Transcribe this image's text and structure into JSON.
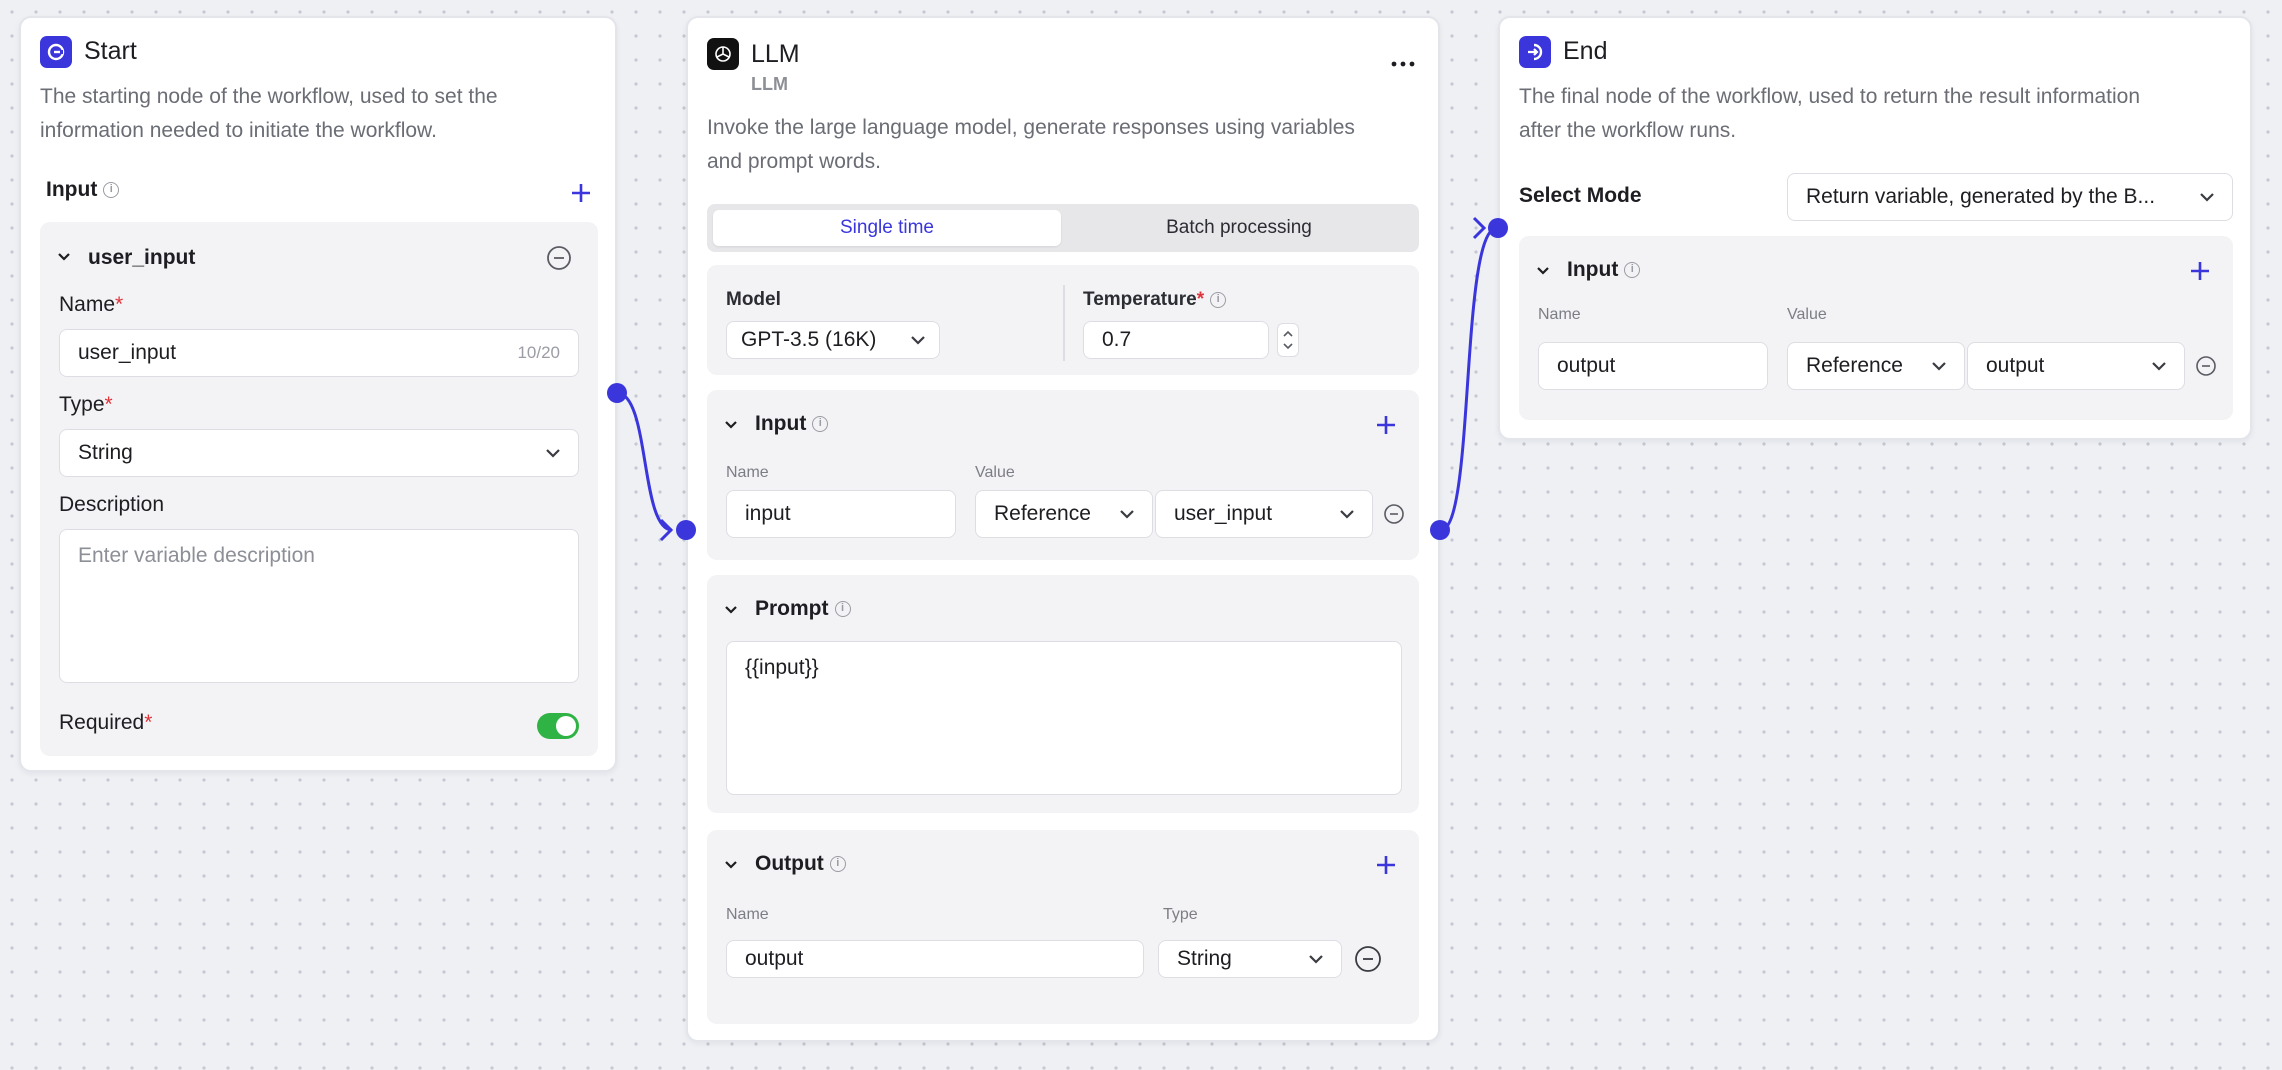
{
  "colors": {
    "accent": "#3a36db",
    "toggle_on": "#2fb344",
    "required": "#e0333a"
  },
  "start": {
    "title": "Start",
    "desc_line1": "The starting node of the workflow, used to set the",
    "desc_line2": "information needed to initiate the workflow.",
    "input_label": "Input",
    "var_name": "user_input",
    "name_label": "Name",
    "name_value": "user_input",
    "name_counter": "10/20",
    "type_label": "Type",
    "type_value": "String",
    "desc_label": "Description",
    "desc_placeholder": "Enter variable description",
    "required_label": "Required",
    "required_on": true
  },
  "llm": {
    "title": "LLM",
    "subtitle": "LLM",
    "desc_line1": "Invoke the large language model, generate responses using variables",
    "desc_line2": "and prompt words.",
    "tab_single": "Single time",
    "tab_batch": "Batch processing",
    "model_label": "Model",
    "model_value": "GPT-3.5 (16K)",
    "temperature_label": "Temperature",
    "temperature_value": "0.7",
    "input_section": "Input",
    "name_col": "Name",
    "value_col": "Value",
    "input_name": "input",
    "input_ref_type": "Reference",
    "input_ref_value": "user_input",
    "prompt_section": "Prompt",
    "prompt_value": "{{input}}",
    "output_section": "Output",
    "out_name_col": "Name",
    "out_type_col": "Type",
    "output_name": "output",
    "output_type": "String"
  },
  "end": {
    "title": "End",
    "desc_line1": "The final node of the workflow, used to return the result information",
    "desc_line2": "after the workflow runs.",
    "select_mode_label": "Select Mode",
    "select_mode_value": "Return variable, generated by the B...",
    "input_section": "Input",
    "name_col": "Name",
    "value_col": "Value",
    "output_name": "output",
    "ref_type": "Reference",
    "ref_value": "output"
  }
}
